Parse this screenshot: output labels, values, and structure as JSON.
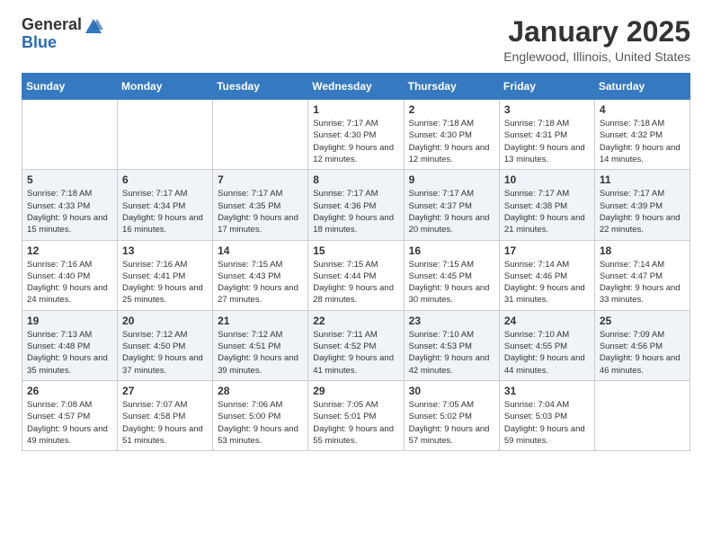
{
  "header": {
    "logo_general": "General",
    "logo_blue": "Blue",
    "month_title": "January 2025",
    "location": "Englewood, Illinois, United States"
  },
  "calendar": {
    "days_of_week": [
      "Sunday",
      "Monday",
      "Tuesday",
      "Wednesday",
      "Thursday",
      "Friday",
      "Saturday"
    ],
    "weeks": [
      [
        {
          "day": "",
          "sunrise": "",
          "sunset": "",
          "daylight": ""
        },
        {
          "day": "",
          "sunrise": "",
          "sunset": "",
          "daylight": ""
        },
        {
          "day": "",
          "sunrise": "",
          "sunset": "",
          "daylight": ""
        },
        {
          "day": "1",
          "sunrise": "Sunrise: 7:17 AM",
          "sunset": "Sunset: 4:30 PM",
          "daylight": "Daylight: 9 hours and 12 minutes."
        },
        {
          "day": "2",
          "sunrise": "Sunrise: 7:18 AM",
          "sunset": "Sunset: 4:30 PM",
          "daylight": "Daylight: 9 hours and 12 minutes."
        },
        {
          "day": "3",
          "sunrise": "Sunrise: 7:18 AM",
          "sunset": "Sunset: 4:31 PM",
          "daylight": "Daylight: 9 hours and 13 minutes."
        },
        {
          "day": "4",
          "sunrise": "Sunrise: 7:18 AM",
          "sunset": "Sunset: 4:32 PM",
          "daylight": "Daylight: 9 hours and 14 minutes."
        }
      ],
      [
        {
          "day": "5",
          "sunrise": "Sunrise: 7:18 AM",
          "sunset": "Sunset: 4:33 PM",
          "daylight": "Daylight: 9 hours and 15 minutes."
        },
        {
          "day": "6",
          "sunrise": "Sunrise: 7:17 AM",
          "sunset": "Sunset: 4:34 PM",
          "daylight": "Daylight: 9 hours and 16 minutes."
        },
        {
          "day": "7",
          "sunrise": "Sunrise: 7:17 AM",
          "sunset": "Sunset: 4:35 PM",
          "daylight": "Daylight: 9 hours and 17 minutes."
        },
        {
          "day": "8",
          "sunrise": "Sunrise: 7:17 AM",
          "sunset": "Sunset: 4:36 PM",
          "daylight": "Daylight: 9 hours and 18 minutes."
        },
        {
          "day": "9",
          "sunrise": "Sunrise: 7:17 AM",
          "sunset": "Sunset: 4:37 PM",
          "daylight": "Daylight: 9 hours and 20 minutes."
        },
        {
          "day": "10",
          "sunrise": "Sunrise: 7:17 AM",
          "sunset": "Sunset: 4:38 PM",
          "daylight": "Daylight: 9 hours and 21 minutes."
        },
        {
          "day": "11",
          "sunrise": "Sunrise: 7:17 AM",
          "sunset": "Sunset: 4:39 PM",
          "daylight": "Daylight: 9 hours and 22 minutes."
        }
      ],
      [
        {
          "day": "12",
          "sunrise": "Sunrise: 7:16 AM",
          "sunset": "Sunset: 4:40 PM",
          "daylight": "Daylight: 9 hours and 24 minutes."
        },
        {
          "day": "13",
          "sunrise": "Sunrise: 7:16 AM",
          "sunset": "Sunset: 4:41 PM",
          "daylight": "Daylight: 9 hours and 25 minutes."
        },
        {
          "day": "14",
          "sunrise": "Sunrise: 7:15 AM",
          "sunset": "Sunset: 4:43 PM",
          "daylight": "Daylight: 9 hours and 27 minutes."
        },
        {
          "day": "15",
          "sunrise": "Sunrise: 7:15 AM",
          "sunset": "Sunset: 4:44 PM",
          "daylight": "Daylight: 9 hours and 28 minutes."
        },
        {
          "day": "16",
          "sunrise": "Sunrise: 7:15 AM",
          "sunset": "Sunset: 4:45 PM",
          "daylight": "Daylight: 9 hours and 30 minutes."
        },
        {
          "day": "17",
          "sunrise": "Sunrise: 7:14 AM",
          "sunset": "Sunset: 4:46 PM",
          "daylight": "Daylight: 9 hours and 31 minutes."
        },
        {
          "day": "18",
          "sunrise": "Sunrise: 7:14 AM",
          "sunset": "Sunset: 4:47 PM",
          "daylight": "Daylight: 9 hours and 33 minutes."
        }
      ],
      [
        {
          "day": "19",
          "sunrise": "Sunrise: 7:13 AM",
          "sunset": "Sunset: 4:48 PM",
          "daylight": "Daylight: 9 hours and 35 minutes."
        },
        {
          "day": "20",
          "sunrise": "Sunrise: 7:12 AM",
          "sunset": "Sunset: 4:50 PM",
          "daylight": "Daylight: 9 hours and 37 minutes."
        },
        {
          "day": "21",
          "sunrise": "Sunrise: 7:12 AM",
          "sunset": "Sunset: 4:51 PM",
          "daylight": "Daylight: 9 hours and 39 minutes."
        },
        {
          "day": "22",
          "sunrise": "Sunrise: 7:11 AM",
          "sunset": "Sunset: 4:52 PM",
          "daylight": "Daylight: 9 hours and 41 minutes."
        },
        {
          "day": "23",
          "sunrise": "Sunrise: 7:10 AM",
          "sunset": "Sunset: 4:53 PM",
          "daylight": "Daylight: 9 hours and 42 minutes."
        },
        {
          "day": "24",
          "sunrise": "Sunrise: 7:10 AM",
          "sunset": "Sunset: 4:55 PM",
          "daylight": "Daylight: 9 hours and 44 minutes."
        },
        {
          "day": "25",
          "sunrise": "Sunrise: 7:09 AM",
          "sunset": "Sunset: 4:56 PM",
          "daylight": "Daylight: 9 hours and 46 minutes."
        }
      ],
      [
        {
          "day": "26",
          "sunrise": "Sunrise: 7:08 AM",
          "sunset": "Sunset: 4:57 PM",
          "daylight": "Daylight: 9 hours and 49 minutes."
        },
        {
          "day": "27",
          "sunrise": "Sunrise: 7:07 AM",
          "sunset": "Sunset: 4:58 PM",
          "daylight": "Daylight: 9 hours and 51 minutes."
        },
        {
          "day": "28",
          "sunrise": "Sunrise: 7:06 AM",
          "sunset": "Sunset: 5:00 PM",
          "daylight": "Daylight: 9 hours and 53 minutes."
        },
        {
          "day": "29",
          "sunrise": "Sunrise: 7:05 AM",
          "sunset": "Sunset: 5:01 PM",
          "daylight": "Daylight: 9 hours and 55 minutes."
        },
        {
          "day": "30",
          "sunrise": "Sunrise: 7:05 AM",
          "sunset": "Sunset: 5:02 PM",
          "daylight": "Daylight: 9 hours and 57 minutes."
        },
        {
          "day": "31",
          "sunrise": "Sunrise: 7:04 AM",
          "sunset": "Sunset: 5:03 PM",
          "daylight": "Daylight: 9 hours and 59 minutes."
        },
        {
          "day": "",
          "sunrise": "",
          "sunset": "",
          "daylight": ""
        }
      ]
    ]
  }
}
